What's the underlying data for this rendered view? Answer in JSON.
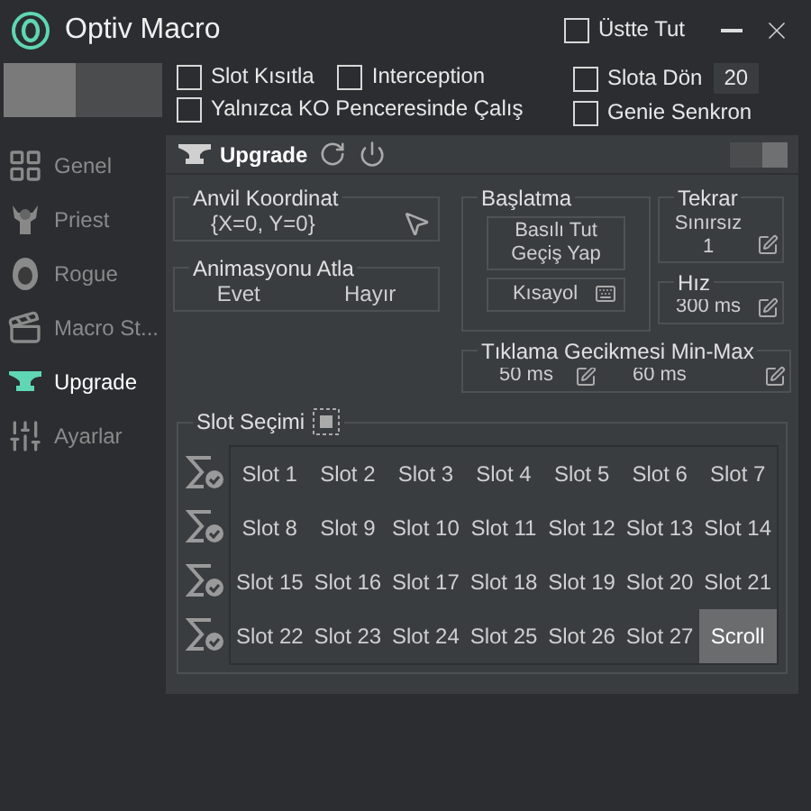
{
  "window": {
    "title": "Optiv Macro"
  },
  "title_options": [
    {
      "label": "Üstte Tut",
      "checked": false
    }
  ],
  "main_toggle": {
    "on": false
  },
  "options": [
    {
      "label": "Slot Kısıtla",
      "checked": false
    },
    {
      "label": "Interception",
      "checked": false
    },
    {
      "label": "Yalnızca KO Penceresinde Çalış",
      "checked": false
    }
  ],
  "right_options": [
    {
      "label": "Slota Dön",
      "checked": false,
      "value": "20"
    },
    {
      "label": "Genie Senkron",
      "checked": false
    }
  ],
  "sidebar": {
    "items": [
      {
        "label": "Genel",
        "kind": "grid",
        "selected": false
      },
      {
        "label": "Priest",
        "kind": "priest",
        "selected": false
      },
      {
        "label": "Rogue",
        "kind": "rogue",
        "selected": false
      },
      {
        "label": "Macro St...",
        "kind": "clapper",
        "selected": false
      },
      {
        "label": "Upgrade",
        "kind": "anvil",
        "selected": true
      },
      {
        "label": "Ayarlar",
        "kind": "sliders",
        "selected": false
      }
    ]
  },
  "panel": {
    "title": "Upgrade",
    "toggle": {
      "on": true
    },
    "anvil": {
      "title": "Anvil Koordinat",
      "value": "{X=0, Y=0}"
    },
    "animation": {
      "title": "Animasyonu Atla",
      "options": [
        "Evet",
        "Hayır"
      ]
    },
    "start": {
      "title": "Başlatma",
      "mode": [
        "Basılı Tut",
        "Geçiş Yap"
      ],
      "hotkey": "Kısayol"
    },
    "repeat": {
      "title": "Tekrar",
      "lines": [
        "Sınırsız",
        "1"
      ]
    },
    "speed": {
      "title": "Hız",
      "value": "300 ms"
    },
    "click_delay": {
      "title": "Tıklama Gecikmesi Min-Max",
      "min": "50 ms",
      "max": "60 ms"
    },
    "slots": {
      "title": "Slot Seçimi",
      "items": [
        {
          "label": "Slot 1",
          "selected": false
        },
        {
          "label": "Slot 2",
          "selected": false
        },
        {
          "label": "Slot 3",
          "selected": false
        },
        {
          "label": "Slot 4",
          "selected": false
        },
        {
          "label": "Slot 5",
          "selected": false
        },
        {
          "label": "Slot 6",
          "selected": false
        },
        {
          "label": "Slot 7",
          "selected": false
        },
        {
          "label": "Slot 8",
          "selected": false
        },
        {
          "label": "Slot 9",
          "selected": false
        },
        {
          "label": "Slot 10",
          "selected": false
        },
        {
          "label": "Slot 11",
          "selected": false
        },
        {
          "label": "Slot 12",
          "selected": false
        },
        {
          "label": "Slot 13",
          "selected": false
        },
        {
          "label": "Slot 14",
          "selected": false
        },
        {
          "label": "Slot 15",
          "selected": false
        },
        {
          "label": "Slot 16",
          "selected": false
        },
        {
          "label": "Slot 17",
          "selected": false
        },
        {
          "label": "Slot 18",
          "selected": false
        },
        {
          "label": "Slot 19",
          "selected": false
        },
        {
          "label": "Slot 20",
          "selected": false
        },
        {
          "label": "Slot 21",
          "selected": false
        },
        {
          "label": "Slot 22",
          "selected": false
        },
        {
          "label": "Slot 23",
          "selected": false
        },
        {
          "label": "Slot 24",
          "selected": false
        },
        {
          "label": "Slot 25",
          "selected": false
        },
        {
          "label": "Slot 26",
          "selected": false
        },
        {
          "label": "Slot 27",
          "selected": false
        },
        {
          "label": "Scroll",
          "selected": true
        }
      ]
    }
  }
}
